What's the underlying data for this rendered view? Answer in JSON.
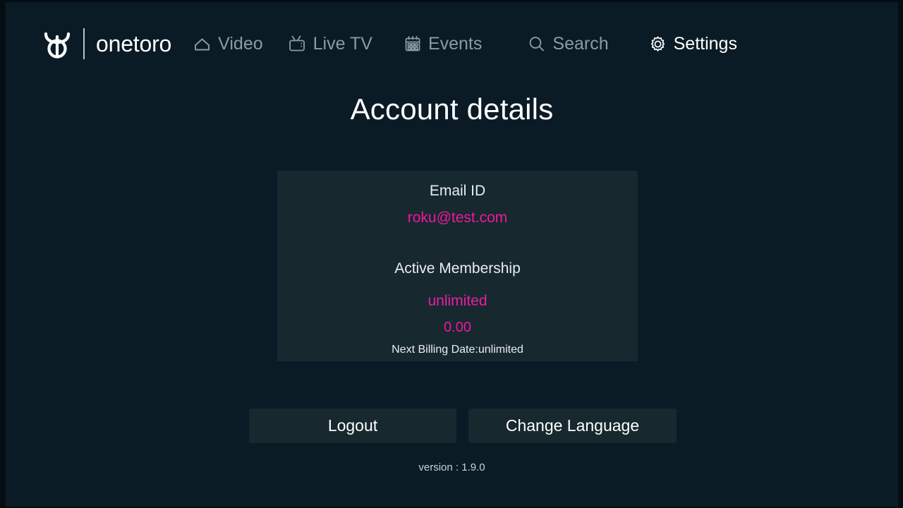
{
  "brand": {
    "logo_icon": "onetoro-bull-logo-icon",
    "name": "onetoro"
  },
  "nav": {
    "items": [
      {
        "id": "video",
        "label": "Video",
        "icon": "home-icon",
        "active": false
      },
      {
        "id": "livetv",
        "label": "Live TV",
        "icon": "tv-icon",
        "active": false
      },
      {
        "id": "events",
        "label": "Events",
        "icon": "calendar-icon",
        "active": false
      },
      {
        "id": "search",
        "label": "Search",
        "icon": "search-icon",
        "active": false
      },
      {
        "id": "settings",
        "label": "Settings",
        "icon": "gear-icon",
        "active": true
      }
    ]
  },
  "page": {
    "title": "Account details"
  },
  "account": {
    "email_label": "Email ID",
    "email_value": "roku@test.com",
    "membership_label": "Active Membership",
    "membership_plan": "unlimited",
    "membership_price": "0.00",
    "next_billing": "Next Billing Date:unlimited"
  },
  "actions": {
    "logout_label": "Logout",
    "change_language_label": "Change Language"
  },
  "footer": {
    "version": "version : 1.9.0"
  },
  "colors": {
    "background": "#0a1b26",
    "card": "#17282f",
    "accent_magenta": "#f0189e",
    "text_primary": "#ffffff",
    "text_muted": "#8c9aa3"
  }
}
